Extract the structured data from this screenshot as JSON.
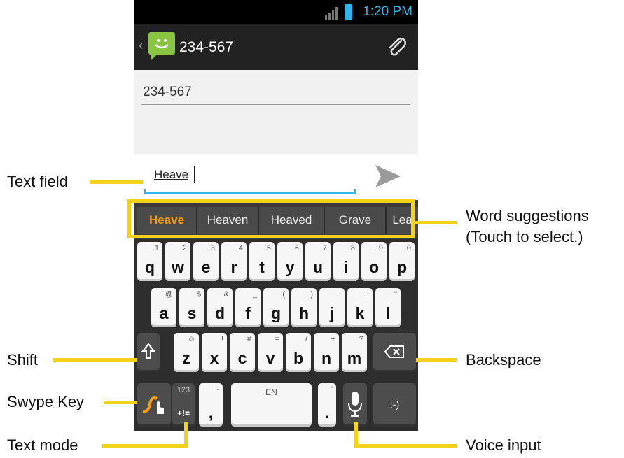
{
  "status": {
    "time": "1:20 PM"
  },
  "header": {
    "title": "234-567",
    "back_glyph": "‹"
  },
  "recipient": {
    "value": "234-567"
  },
  "compose": {
    "value": "Heave"
  },
  "suggestions": [
    "Heave",
    "Heaven",
    "Heaved",
    "Grave",
    "Lea"
  ],
  "keyboard": {
    "row1": [
      {
        "k": "q",
        "a": "1"
      },
      {
        "k": "w",
        "a": "2"
      },
      {
        "k": "e",
        "a": "3"
      },
      {
        "k": "r",
        "a": "4"
      },
      {
        "k": "t",
        "a": "5"
      },
      {
        "k": "y",
        "a": "6"
      },
      {
        "k": "u",
        "a": "7"
      },
      {
        "k": "i",
        "a": "8"
      },
      {
        "k": "o",
        "a": "9"
      },
      {
        "k": "p",
        "a": "0"
      }
    ],
    "row2": [
      {
        "k": "a",
        "a": "@"
      },
      {
        "k": "s",
        "a": "$"
      },
      {
        "k": "d",
        "a": "&"
      },
      {
        "k": "f",
        "a": "_"
      },
      {
        "k": "g",
        "a": "("
      },
      {
        "k": "h",
        "a": ")"
      },
      {
        "k": "j",
        "a": ":"
      },
      {
        "k": "k",
        "a": ";"
      },
      {
        "k": "l",
        "a": "\""
      }
    ],
    "row3": [
      {
        "k": "z",
        "a": "☺"
      },
      {
        "k": "x",
        "a": "!"
      },
      {
        "k": "c",
        "a": "#"
      },
      {
        "k": "v",
        "a": "="
      },
      {
        "k": "b",
        "a": "/"
      },
      {
        "k": "n",
        "a": "+"
      },
      {
        "k": "m",
        "a": "?"
      }
    ],
    "mode_top": "123",
    "mode_bottom": "+!=",
    "comma": ",",
    "comma_alt": "-",
    "space_label": "EN",
    "period": ".",
    "period_alt": "'",
    "smiley": ":-)"
  },
  "callouts": {
    "text_field": "Text field",
    "word_suggestions": "Word suggestions",
    "touch_to_select": "(Touch to select.)",
    "shift": "Shift",
    "backspace": "Backspace",
    "swype_key": "Swype Key",
    "text_mode": "Text mode",
    "voice_input": "Voice input"
  },
  "colors": {
    "accent": "#33b5e5",
    "callout": "#f2d31b",
    "suggestion_active": "#f39c12"
  }
}
